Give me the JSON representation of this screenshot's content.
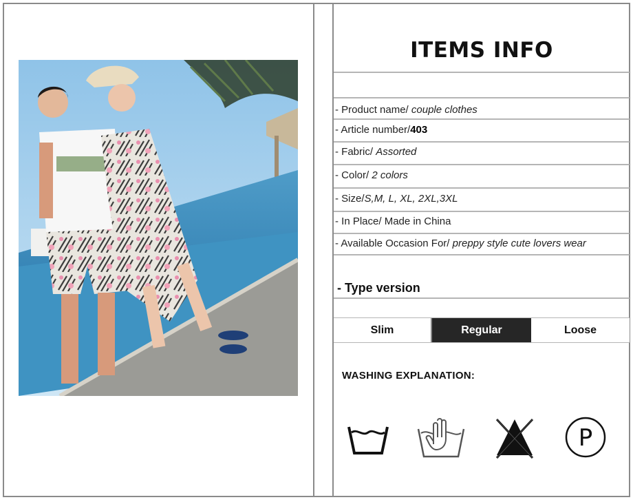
{
  "info": {
    "title": "ITEMS INFO",
    "rows": [
      {
        "label": "- Product name/",
        "value": "couple clothes"
      },
      {
        "label": "- Article number/",
        "value": "403"
      },
      {
        "label": "- Fabric/",
        "value": "Assorted"
      },
      {
        "label": "- Color/",
        "value": "2 colors"
      },
      {
        "label": "- Size/",
        "value": "S,M, L, XL, 2XL,3XL"
      },
      {
        "label": "- In Place/",
        "value": "Made in China"
      },
      {
        "label": "- Available Occasion For/",
        "value": "preppy style cute lovers wear"
      }
    ]
  },
  "type_version": {
    "heading": "- Type version",
    "options": [
      "Slim",
      "Regular",
      "Loose"
    ],
    "selected": "Regular"
  },
  "washing": {
    "heading": "WASHING EXPLANATION:",
    "icons": [
      "machine-wash-icon",
      "hand-wash-icon",
      "do-not-bleach-icon",
      "dry-clean-p-icon"
    ],
    "dry_clean_letter": "P"
  },
  "colors": {
    "border": "#8a8a8a",
    "selected_bg": "#262626",
    "selected_text": "#ffffff"
  }
}
